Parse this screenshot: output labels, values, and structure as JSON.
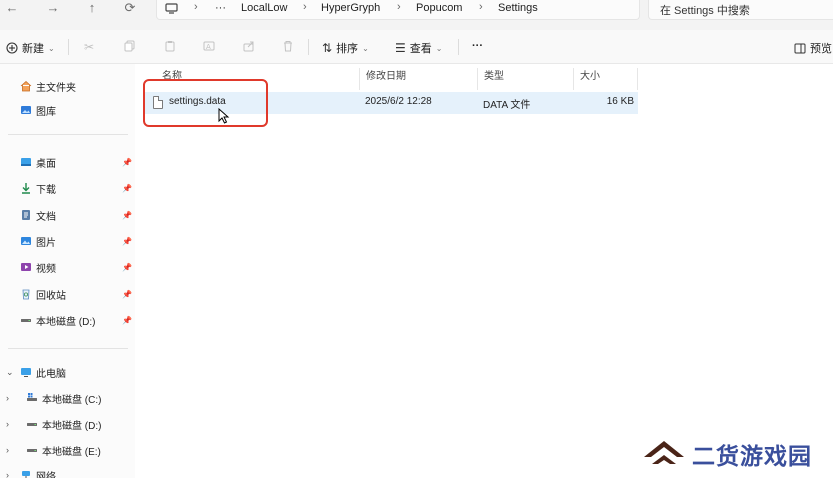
{
  "nav": {
    "back": "←",
    "forward": "→",
    "up": "↑",
    "refresh": "⟳"
  },
  "address": {
    "computer_icon": "monitor-icon",
    "overflow": "···",
    "segments": [
      "LocalLow",
      "HyperGryph",
      "Popucom",
      "Settings"
    ]
  },
  "search": {
    "placeholder": "在 Settings 中搜索"
  },
  "commandbar": {
    "new_label": "新建",
    "sort_label": "排序",
    "view_label": "查看",
    "more_label": "···",
    "preview_label": "预览"
  },
  "sidebar": {
    "quick": [
      {
        "label": "主文件夹",
        "icon": "home-icon"
      },
      {
        "label": "图库",
        "icon": "gallery-icon"
      }
    ],
    "pinned": [
      {
        "label": "桌面",
        "icon": "desktop-icon"
      },
      {
        "label": "下载",
        "icon": "download-icon"
      },
      {
        "label": "文档",
        "icon": "document-icon"
      },
      {
        "label": "图片",
        "icon": "picture-icon"
      },
      {
        "label": "视频",
        "icon": "video-icon"
      },
      {
        "label": "回收站",
        "icon": "recycle-bin-icon"
      },
      {
        "label": "本地磁盘 (D:)",
        "icon": "drive-icon"
      }
    ],
    "this_pc": "此电脑",
    "drives": [
      "本地磁盘 (C:)",
      "本地磁盘 (D:)",
      "本地磁盘 (E:)"
    ],
    "network": "网络"
  },
  "columns": {
    "name": "名称",
    "modified": "修改日期",
    "type": "类型",
    "size": "大小"
  },
  "files": [
    {
      "name": "settings.data",
      "modified": "2025/6/2 12:28",
      "type": "DATA 文件",
      "size": "16 KB"
    }
  ],
  "watermark": {
    "text": "二货游戏园"
  },
  "colors": {
    "highlight_row": "#e5f1fb",
    "annotation_red": "#e0392b",
    "watermark_blue": "#3a4f9c"
  }
}
